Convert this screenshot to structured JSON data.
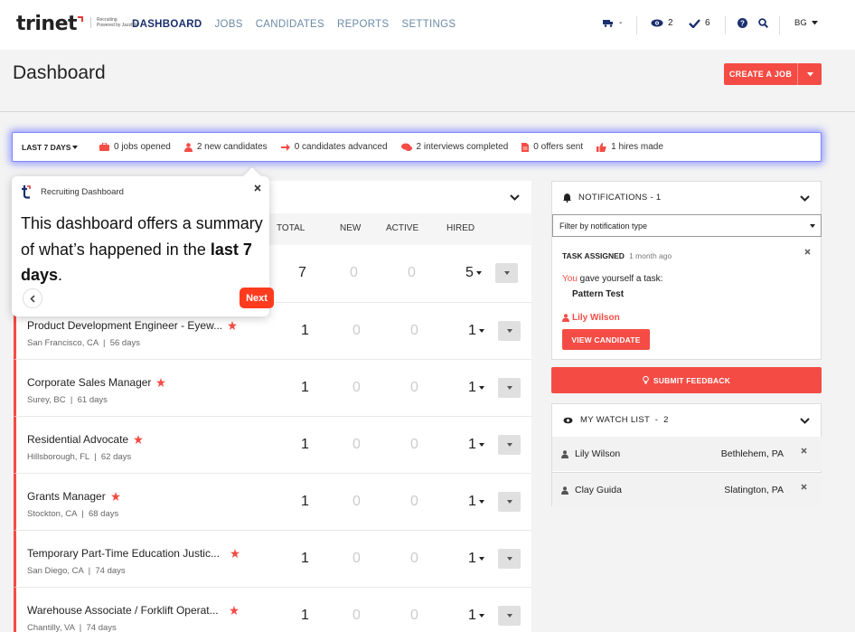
{
  "brand": {
    "name": "trinet",
    "sub_line1": "Recruiting",
    "sub_line2": "Powered by JazzHR"
  },
  "nav": {
    "links": [
      "DASHBOARD",
      "JOBS",
      "CANDIDATES",
      "REPORTS",
      "SETTINGS"
    ],
    "active": "DASHBOARD",
    "queue_count": "-",
    "watch_count": "2",
    "tasks_count": "6",
    "user_initials": "BG"
  },
  "page": {
    "title": "Dashboard",
    "create_button": "CREATE A JOB"
  },
  "summary": {
    "range_label": "LAST 7 DAYS",
    "items": [
      "0 jobs opened",
      "2 new candidates",
      "0 candidates advanced",
      "2 interviews completed",
      "0 offers sent",
      "1 hires made"
    ]
  },
  "jobs_table": {
    "columns": [
      "TOTAL",
      "NEW",
      "ACTIVE",
      "HIRED"
    ],
    "summary_row": {
      "total": "7",
      "new": "0",
      "active": "0",
      "hired": "5"
    },
    "rows": [
      {
        "title": "Product Development Engineer - Eyew...",
        "location": "San Francisco, CA",
        "age": "56 days",
        "total": "1",
        "new": "0",
        "active": "0",
        "hired": "1"
      },
      {
        "title": "Corporate Sales Manager",
        "location": "Surey, BC",
        "age": "61 days",
        "total": "1",
        "new": "0",
        "active": "0",
        "hired": "1"
      },
      {
        "title": "Residential Advocate",
        "location": "Hillsborough, FL",
        "age": "62 days",
        "total": "1",
        "new": "0",
        "active": "0",
        "hired": "1"
      },
      {
        "title": "Grants Manager",
        "location": "Stockton, CA",
        "age": "68 days",
        "total": "1",
        "new": "0",
        "active": "0",
        "hired": "1"
      },
      {
        "title": "Temporary Part-Time Education Justic...",
        "location": "San Diego, CA",
        "age": "74 days",
        "total": "1",
        "new": "0",
        "active": "0",
        "hired": "1"
      },
      {
        "title": "Warehouse Associate / Forklift Operat...",
        "location": "Chantilly, VA",
        "age": "74 days",
        "total": "1",
        "new": "0",
        "active": "0",
        "hired": "1"
      }
    ]
  },
  "popover": {
    "header": "Recruiting Dashboard",
    "body_prefix": "This dashboard offers a summary of what’s happened in the ",
    "body_bold": "last 7 days",
    "body_suffix": ".",
    "next_label": "Next"
  },
  "notifications": {
    "header": "NOTIFICATIONS - 1",
    "filter_placeholder": "Filter by notification type",
    "task_title": "TASK ASSIGNED",
    "task_time": "1 month ago",
    "task_you": "You",
    "task_text": " gave yourself a task:",
    "task_name": "Pattern Test",
    "task_person": "Lily Wilson",
    "view_button": "VIEW CANDIDATE"
  },
  "feedback_button": "SUBMIT FEEDBACK",
  "watch_list": {
    "header": "MY WATCH LIST  -  2",
    "items": [
      {
        "name": "Lily Wilson",
        "location": "Bethlehem, PA"
      },
      {
        "name": "Clay Guida",
        "location": "Slatington, PA"
      }
    ]
  },
  "colors": {
    "accent": "#f44c45",
    "nav_active": "#1a2f6e",
    "nav_link": "#6a8aa6",
    "highlight": "#7b86ff",
    "next_button": "#ff3b1f"
  }
}
